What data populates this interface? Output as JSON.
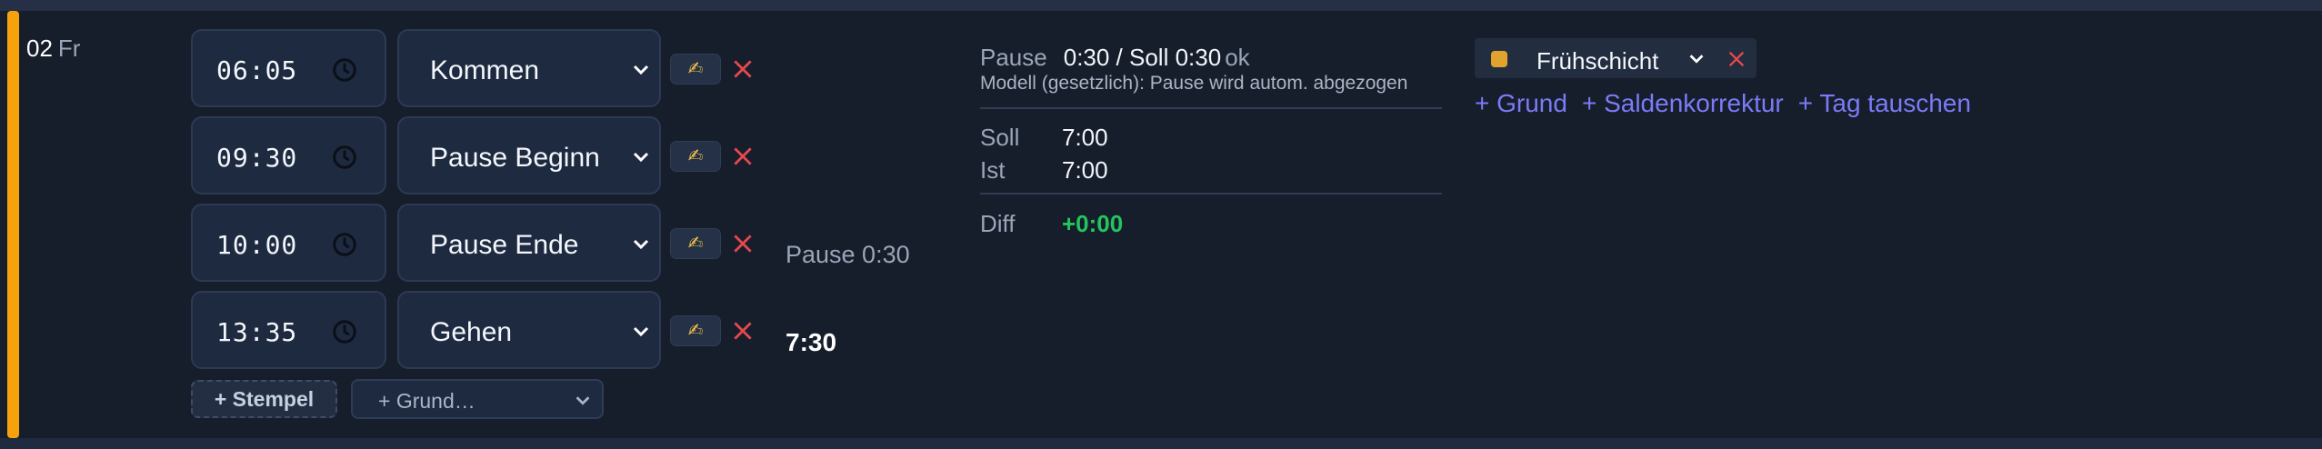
{
  "day": {
    "number": "02",
    "weekday": "Fr"
  },
  "stamps": [
    {
      "time": "06:05",
      "type": "Kommen"
    },
    {
      "time": "09:30",
      "type": "Pause Beginn"
    },
    {
      "time": "10:00",
      "type": "Pause Ende"
    },
    {
      "time": "13:35",
      "type": "Gehen"
    }
  ],
  "edit_icon_glyph": "✍",
  "pause_note": "Pause 0:30",
  "work_total": "7:30",
  "add_stamp_label": "+ Stempel",
  "grund_select_value": "+ Grund…",
  "summary": {
    "pause_label": "Pause",
    "pause_value": "0:30 / Soll 0:30",
    "pause_status": "ok",
    "model_text": "Modell (gesetzlich): Pause wird autom. abgezogen",
    "soll_label": "Soll",
    "soll_value": "7:00",
    "ist_label": "Ist",
    "ist_value": "7:00",
    "diff_label": "Diff",
    "diff_value": "+0:00"
  },
  "shift": {
    "label": "Frühschicht",
    "color": "#e0a42e"
  },
  "links": {
    "grund": "+ Grund",
    "saldenkorrektur": "+ Saldenkorrektur",
    "tag_tauschen": "+ Tag tauschen"
  },
  "colors": {
    "accent": "#f5a30c",
    "positive": "#22c55e",
    "link": "#7b7bf6",
    "delete": "#e5484d"
  }
}
